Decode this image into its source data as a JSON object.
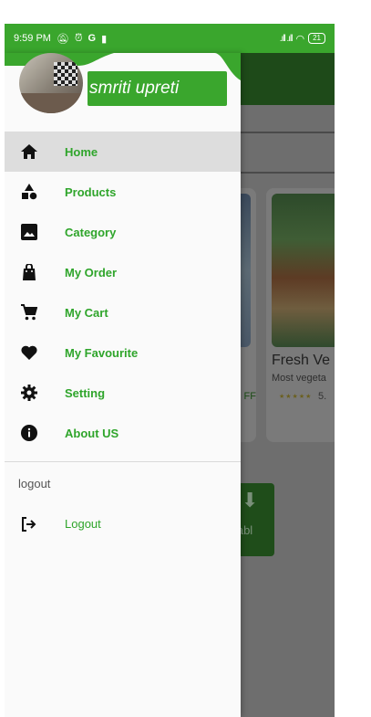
{
  "status_bar": {
    "time": "9:59 PM",
    "battery": "21"
  },
  "drawer": {
    "user_name": "smriti upreti",
    "menu": [
      {
        "label": "Home",
        "icon": "home-icon",
        "active": true
      },
      {
        "label": "Products",
        "icon": "shapes-icon",
        "active": false
      },
      {
        "label": "Category",
        "icon": "image-icon",
        "active": false
      },
      {
        "label": "My Order",
        "icon": "shopping-bag-icon",
        "active": false
      },
      {
        "label": "My Cart",
        "icon": "cart-icon",
        "active": false
      },
      {
        "label": "My Favourite",
        "icon": "heart-icon",
        "active": false
      },
      {
        "label": "Setting",
        "icon": "gear-icon",
        "active": false
      },
      {
        "label": "About US",
        "icon": "info-icon",
        "active": false
      }
    ],
    "section_label": "logout",
    "logout_label": "Logout"
  },
  "background": {
    "card_title": "Fresh Ve",
    "card_subtitle": "Most vegeta",
    "card_stars": "★★★★★",
    "card_rating": "5.",
    "card1_tag": "FF",
    "tile_text1": "etabl",
    "tile_text2": "e"
  },
  "colors": {
    "accent": "#3aa62d",
    "menu_text": "#2fa52b",
    "active_bg": "#dddddd"
  }
}
